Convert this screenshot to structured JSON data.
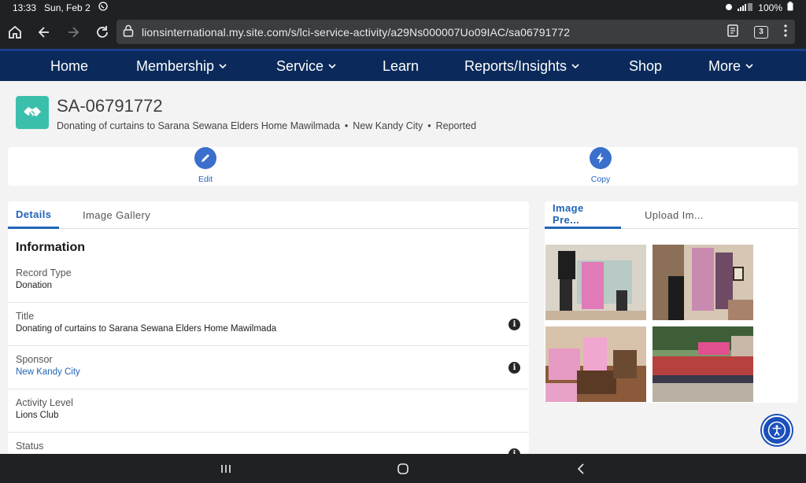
{
  "status": {
    "time": "13:33",
    "date": "Sun, Feb 2",
    "battery": "100%"
  },
  "browser": {
    "url": "lionsinternational.my.site.com/s/lci-service-activity/a29Ns000007Uo09IAC/sa06791772",
    "tab_count": "3"
  },
  "nav": {
    "home": "Home",
    "membership": "Membership",
    "service": "Service",
    "learn": "Learn",
    "reports": "Reports/Insights",
    "shop": "Shop",
    "more": "More"
  },
  "record": {
    "id": "SA-06791772",
    "subtitle_title": "Donating of curtains to Sarana Sewana Elders Home Mawilmada",
    "subtitle_club": "New Kandy City",
    "subtitle_status": "Reported"
  },
  "actions": {
    "edit": "Edit",
    "copy": "Copy"
  },
  "details_tabs": {
    "details": "Details",
    "gallery": "Image Gallery"
  },
  "information": {
    "heading": "Information",
    "fields": [
      {
        "label": "Record Type",
        "value": "Donation"
      },
      {
        "label": "Title",
        "value": "Donating of curtains to Sarana Sewana Elders Home Mawilmada"
      },
      {
        "label": "Sponsor",
        "value": "New Kandy City"
      },
      {
        "label": "Activity Level",
        "value": "Lions Club"
      },
      {
        "label": "Status",
        "value": ""
      }
    ]
  },
  "image_tabs": {
    "preview": "Image Pre...",
    "upload": "Upload Im..."
  },
  "colors": {
    "nav_bg": "#0b2a5b",
    "accent": "#2264b8",
    "record_icon": "#3bbfad"
  }
}
